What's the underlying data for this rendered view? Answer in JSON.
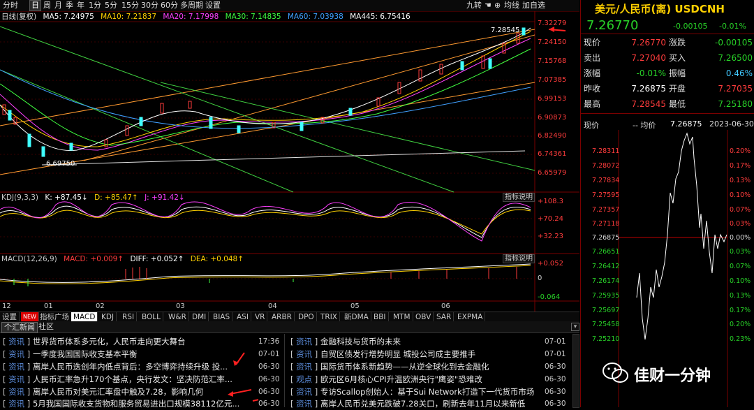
{
  "toolbar": {
    "periods": [
      "分时",
      "日",
      "周",
      "月",
      "季",
      "年",
      "1分",
      "5分",
      "15分",
      "30分",
      "60分",
      "多周期",
      "设置"
    ],
    "active": "日",
    "right": [
      "九转",
      "均线",
      "加自选"
    ]
  },
  "main_chart": {
    "legend_label": "日线(复权)",
    "ma": [
      {
        "label": "MA5: 7.24975",
        "color": "#ffffff"
      },
      {
        "label": "MA10: 7.21837",
        "color": "#ffd000"
      },
      {
        "label": "MA20: 7.17998",
        "color": "#ff40ff"
      },
      {
        "label": "MA30: 7.14835",
        "color": "#40ff40"
      },
      {
        "label": "MA60: 7.03938",
        "color": "#40a0ff"
      },
      {
        "label": "MA445: 6.75416",
        "color": "#ffffff"
      }
    ],
    "y_ticks": [
      "7.32279",
      "7.24150",
      "7.15768",
      "7.07385",
      "6.99153",
      "6.90873",
      "6.82490",
      "6.74361",
      "6.65979"
    ],
    "high_label": "7.28545",
    "low_label": "6.69750"
  },
  "kdj": {
    "label": "KDJ(9,3,3)",
    "k": "K: +87.45↓",
    "d": "D: +85.47↑",
    "j": "J: +91.42↓",
    "ticks": [
      "+108.3",
      "+70.24",
      "+32.23"
    ],
    "explain": "指标说明"
  },
  "macd": {
    "label": "MACD(12,26,9)",
    "macd": "MACD: +0.009↑",
    "diff": "DIFF: +0.052↑",
    "dea": "DEA: +0.048↑",
    "ticks": [
      "+0.052",
      "0",
      "-0.064"
    ],
    "explain": "指标说明"
  },
  "months": [
    "12",
    "01",
    "02",
    "03",
    "04",
    "05",
    "06"
  ],
  "indicator_tabs": [
    "设置",
    "NEW",
    "指标广场",
    "MACD",
    "KDJ",
    "RSI",
    "BOLL",
    "W&R",
    "DMI",
    "BIAS",
    "ASI",
    "VR",
    "ARBR",
    "DPO",
    "TRIX",
    "新DMA",
    "BBI",
    "MTM",
    "OBV",
    "SAR",
    "EXPMA"
  ],
  "indicator_active": "MACD",
  "news_tabs": [
    "个汇新闻",
    "社区"
  ],
  "news_left": [
    {
      "tag": "资讯",
      "title": "世界货币体系多元化，人民币走向更大舞台",
      "date": "17:36"
    },
    {
      "tag": "资讯",
      "title": "一季度我国国际收支基本平衡",
      "date": "07-01"
    },
    {
      "tag": "资讯",
      "title": "离岸人民币迭创年内低点背后：多空博弈持续升级 投...",
      "date": "06-30"
    },
    {
      "tag": "资讯",
      "title": "人民币汇率急升170个基点，央行发文：坚决防范汇率...",
      "date": "06-30"
    },
    {
      "tag": "资讯",
      "title": "离岸人民币对美元汇率盘中触及7.28，影响几何",
      "date": "06-30"
    },
    {
      "tag": "资讯",
      "title": "5月我国国际收支货物和服务贸易进出口规模38112亿元...",
      "date": "06-30"
    }
  ],
  "news_right": [
    {
      "tag": "资讯",
      "title": "金融科技与货币的未来",
      "date": "07-01"
    },
    {
      "tag": "资讯",
      "title": "自贸区债发行增势明显 城投公司成主要推手",
      "date": "07-01"
    },
    {
      "tag": "资讯",
      "title": "国际货币体系新趋势——从逆全球化到去金融化",
      "date": "06-30"
    },
    {
      "tag": "观点",
      "title": "欧元区6月核心CPI升温欧洲央行\"鹰姿\"恐难改",
      "date": "06-30"
    },
    {
      "tag": "资讯",
      "title": "专访Scallop创始人：基于Sui Network打造下一代货币市场",
      "date": "06-30"
    },
    {
      "tag": "资讯",
      "title": "离岸人民币兑美元跌破7.28关口，刷新去年11月以来新低",
      "date": "06-30"
    }
  ],
  "quote": {
    "title": "美元/人民币(离) USDCNH",
    "price": "7.26770",
    "change": "-0.00105",
    "change_pct": "-0.01%",
    "rows": [
      {
        "l1": "现价",
        "v1": "7.26770",
        "c1": "#ff3c3c",
        "l2": "涨跌",
        "v2": "-0.00105",
        "c2": "#28d228"
      },
      {
        "l1": "卖出",
        "v1": "7.27040",
        "c1": "#ff3c3c",
        "l2": "买入",
        "v2": "7.26500",
        "c2": "#28d228"
      },
      {
        "l1": "涨幅",
        "v1": "-0.01%",
        "c1": "#28d228",
        "l2": "振幅",
        "v2": "0.46%",
        "c2": "#40c8ff"
      },
      {
        "l1": "昨收",
        "v1": "7.26875",
        "c1": "#ffffff",
        "l2": "开盘",
        "v2": "7.27035",
        "c2": "#ff3c3c"
      },
      {
        "l1": "最高",
        "v1": "7.28545",
        "c1": "#ff3c3c",
        "l2": "最低",
        "v2": "7.25180",
        "c2": "#28d228"
      }
    ]
  },
  "mini_chart": {
    "header_now": "现价",
    "header_avg": "-- 均价",
    "header_prev": "7.26875",
    "header_date": "2023-06-30",
    "left_ticks": [
      "7.28311",
      "7.28072",
      "7.27834",
      "7.27595",
      "7.27357",
      "7.27118",
      "7.26875",
      "7.26651",
      "7.26412",
      "7.26174",
      "7.25935",
      "7.25697",
      "7.25458",
      "7.25210"
    ],
    "right_ticks": [
      "0.20%",
      "0.17%",
      "0.13%",
      "0.10%",
      "0.07%",
      "0.03%",
      "0.00%",
      "0.03%",
      "0.07%",
      "0.10%",
      "0.13%",
      "0.17%",
      "0.20%",
      "0.23%"
    ]
  },
  "watermark": "佳财一分钟"
}
